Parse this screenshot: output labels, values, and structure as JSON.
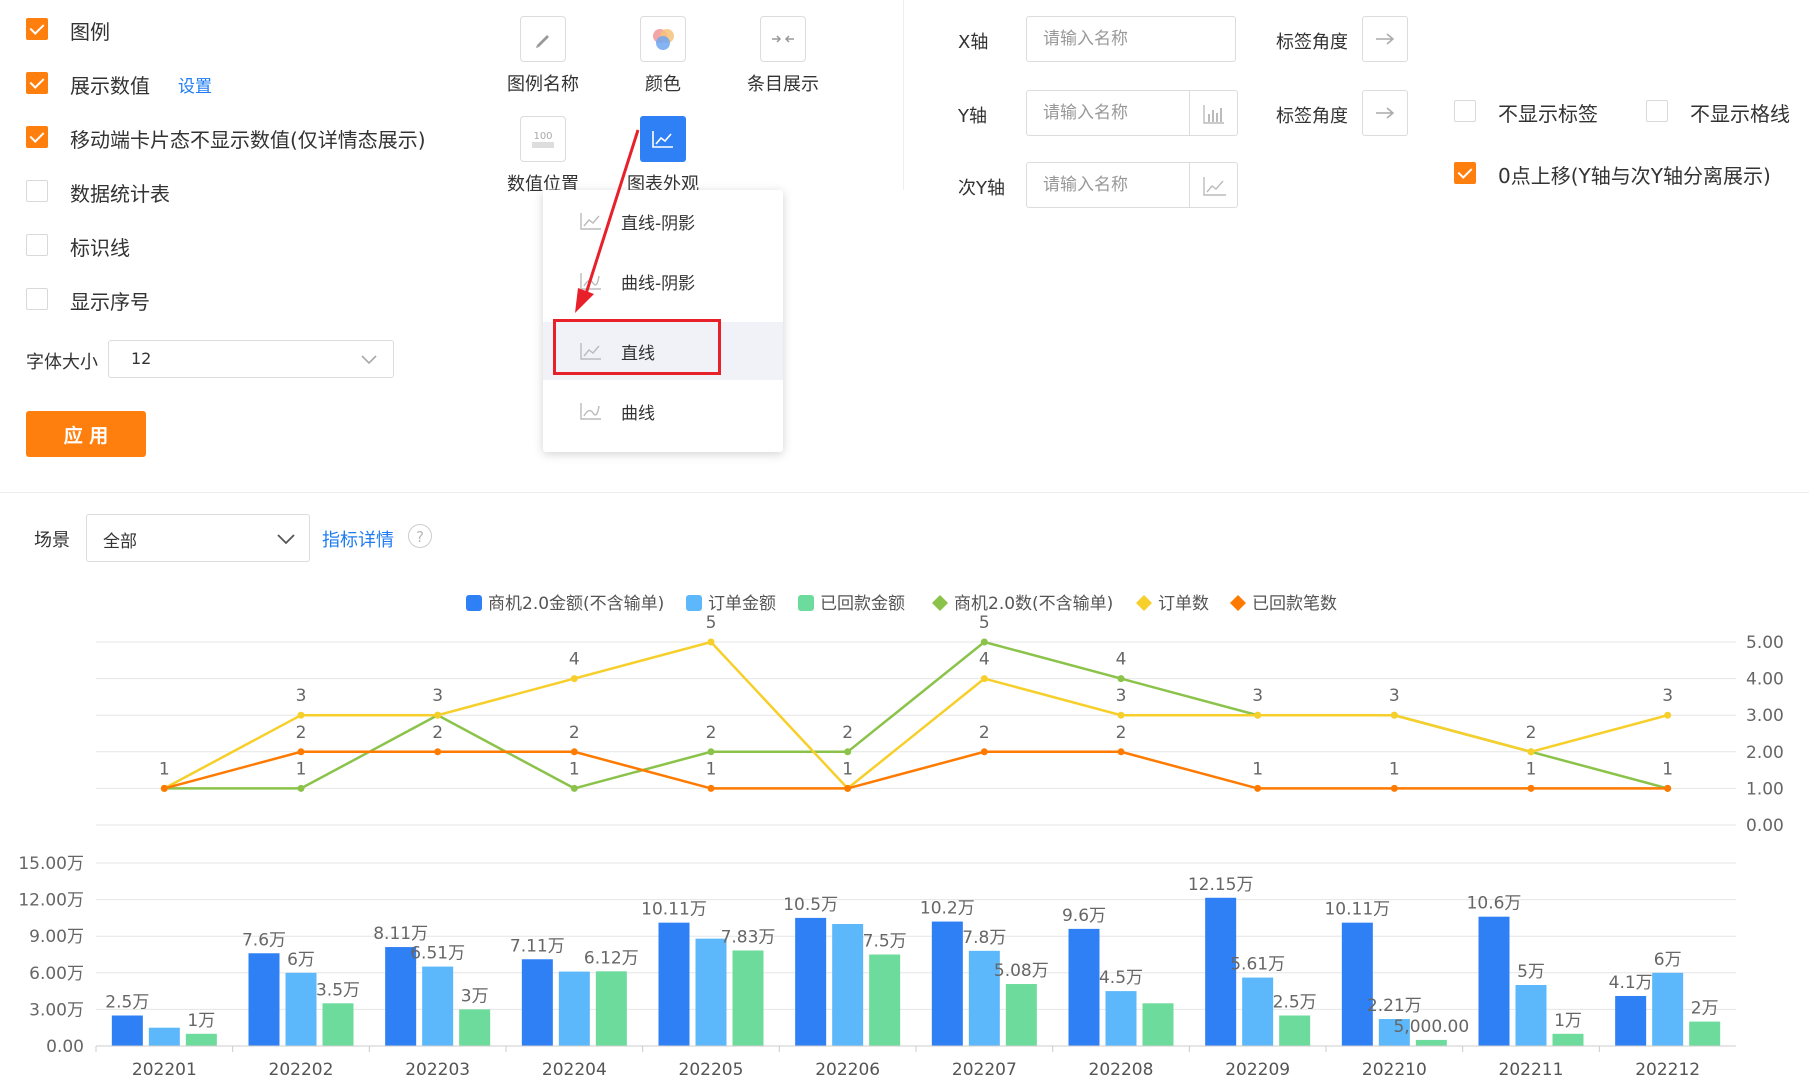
{
  "settings": {
    "options": [
      {
        "label": "图例",
        "checked": true
      },
      {
        "label": "展示数值",
        "checked": true
      },
      {
        "label": "移动端卡片态不显示数值(仅详情态展示)",
        "checked": true
      },
      {
        "label": "数据统计表",
        "checked": false
      },
      {
        "label": "标识线",
        "checked": false
      },
      {
        "label": "显示序号",
        "checked": false
      }
    ],
    "show_values_link": "设置",
    "font_size_label": "字体大小",
    "font_size_value": "12",
    "apply_label": "应 用"
  },
  "tools": {
    "legend_name": "图例名称",
    "color": "颜色",
    "item_display": "条目展示",
    "value_position": "数值位置",
    "value_icon_text": "100",
    "chart_appearance": "图表外观"
  },
  "appearance_menu": {
    "items": [
      "直线-阴影",
      "曲线-阴影",
      "直线",
      "曲线"
    ],
    "selected": "直线"
  },
  "axes": {
    "x_label": "X轴",
    "y_label": "Y轴",
    "y2_label": "次Y轴",
    "placeholder": "请输入名称",
    "label_angle": "标签角度",
    "hide_labels": "不显示标签",
    "hide_gridlines": "不显示格线",
    "zero_shift": "0点上移(Y轴与次Y轴分离展示)",
    "hide_labels_checked": false,
    "hide_gridlines_checked": false,
    "zero_shift_checked": true
  },
  "filters": {
    "scene_label": "场景",
    "scene_value": "全部",
    "metric_detail_link": "指标详情",
    "help_icon": "?"
  },
  "colors": {
    "accent": "#ff7f0e",
    "link": "#1e7cf3",
    "bar1": "#2f7ff5",
    "bar2": "#5cb8fa",
    "bar3": "#6ddb9b",
    "line1": "#8bc34a",
    "line2": "#f7cf2b",
    "line3": "#ff7a00",
    "highlight": "#e8202a"
  },
  "chart_data": {
    "type": "bar",
    "categories": [
      "202201",
      "202202",
      "202203",
      "202204",
      "202205",
      "202206",
      "202207",
      "202208",
      "202209",
      "202210",
      "202211",
      "202212"
    ],
    "legend": [
      "商机2.0金额(不含输单)",
      "订单金额",
      "已回款金额",
      "商机2.0数(不含输单)",
      "订单数",
      "已回款笔数"
    ],
    "bar_series": [
      {
        "name": "商机2.0金额(不含输单)",
        "values": [
          25000,
          76000,
          81100,
          71100,
          101100,
          105000,
          102000,
          96000,
          121500,
          101100,
          106000,
          41000
        ],
        "labels": [
          "2.5万",
          "7.6万",
          "8.11万",
          "7.11万",
          "10.11万",
          "10.5万",
          "10.2万",
          "9.6万",
          "12.15万",
          "10.11万",
          "10.6万",
          "4.1万"
        ]
      },
      {
        "name": "订单金额",
        "values": [
          15000,
          60000,
          65100,
          61000,
          88000,
          100000,
          78000,
          45000,
          56100,
          22100,
          50000,
          60000
        ],
        "labels": [
          "",
          "6万",
          "6.51万",
          "",
          "",
          "",
          "7.8万",
          "4.5万",
          "5.61万",
          "2.21万",
          "5万",
          "6万"
        ]
      },
      {
        "name": "已回款金额",
        "values": [
          10000,
          35000,
          30000,
          61200,
          78300,
          75000,
          50800,
          35000,
          25000,
          5000,
          10000,
          20000
        ],
        "labels": [
          "1万",
          "3.5万",
          "3万",
          "6.12万",
          "7.83万",
          "7.5万",
          "5.08万",
          "",
          "2.5万",
          "5,000.00",
          "1万",
          "2万"
        ]
      }
    ],
    "line_series": [
      {
        "name": "商机2.0数(不含输单)",
        "values": [
          1,
          1,
          3,
          1,
          2,
          2,
          5,
          4,
          3,
          3,
          2,
          1
        ]
      },
      {
        "name": "订单数",
        "values": [
          1,
          3,
          3,
          4,
          5,
          1,
          4,
          3,
          3,
          3,
          2,
          3
        ]
      },
      {
        "name": "已回款笔数",
        "values": [
          1,
          2,
          2,
          2,
          1,
          1,
          2,
          2,
          1,
          1,
          1,
          1
        ]
      }
    ],
    "line_labels": [
      {
        "i": 0,
        "text": "1"
      },
      {
        "i": 1,
        "text": "3"
      },
      {
        "i": 1,
        "text": "2"
      },
      {
        "i": 1,
        "text": "1"
      },
      {
        "i": 2,
        "text": "3"
      },
      {
        "i": 2,
        "text": "2"
      },
      {
        "i": 3,
        "text": "4"
      },
      {
        "i": 3,
        "text": "2"
      },
      {
        "i": 3,
        "text": "1"
      },
      {
        "i": 4,
        "text": "5"
      },
      {
        "i": 4,
        "text": "2"
      },
      {
        "i": 4,
        "text": "1"
      },
      {
        "i": 5,
        "text": "2"
      },
      {
        "i": 5,
        "text": "1"
      },
      {
        "i": 6,
        "text": "5"
      },
      {
        "i": 6,
        "text": "4"
      },
      {
        "i": 6,
        "text": "2"
      },
      {
        "i": 7,
        "text": "4"
      },
      {
        "i": 7,
        "text": "3"
      },
      {
        "i": 7,
        "text": "2"
      },
      {
        "i": 8,
        "text": "3"
      },
      {
        "i": 8,
        "text": "1"
      },
      {
        "i": 9,
        "text": "3"
      },
      {
        "i": 9,
        "text": "1"
      },
      {
        "i": 10,
        "text": "2"
      },
      {
        "i": 10,
        "text": "1"
      },
      {
        "i": 11,
        "text": "3"
      },
      {
        "i": 11,
        "text": "1"
      }
    ],
    "y_left_ticks": [
      "0.00",
      "3.00万",
      "6.00万",
      "9.00万",
      "12.00万",
      "15.00万"
    ],
    "y_left_max": 150000,
    "y_right_ticks": [
      "0.00",
      "1.00",
      "2.00",
      "3.00",
      "4.00",
      "5.00"
    ],
    "y_right_max": 5
  }
}
